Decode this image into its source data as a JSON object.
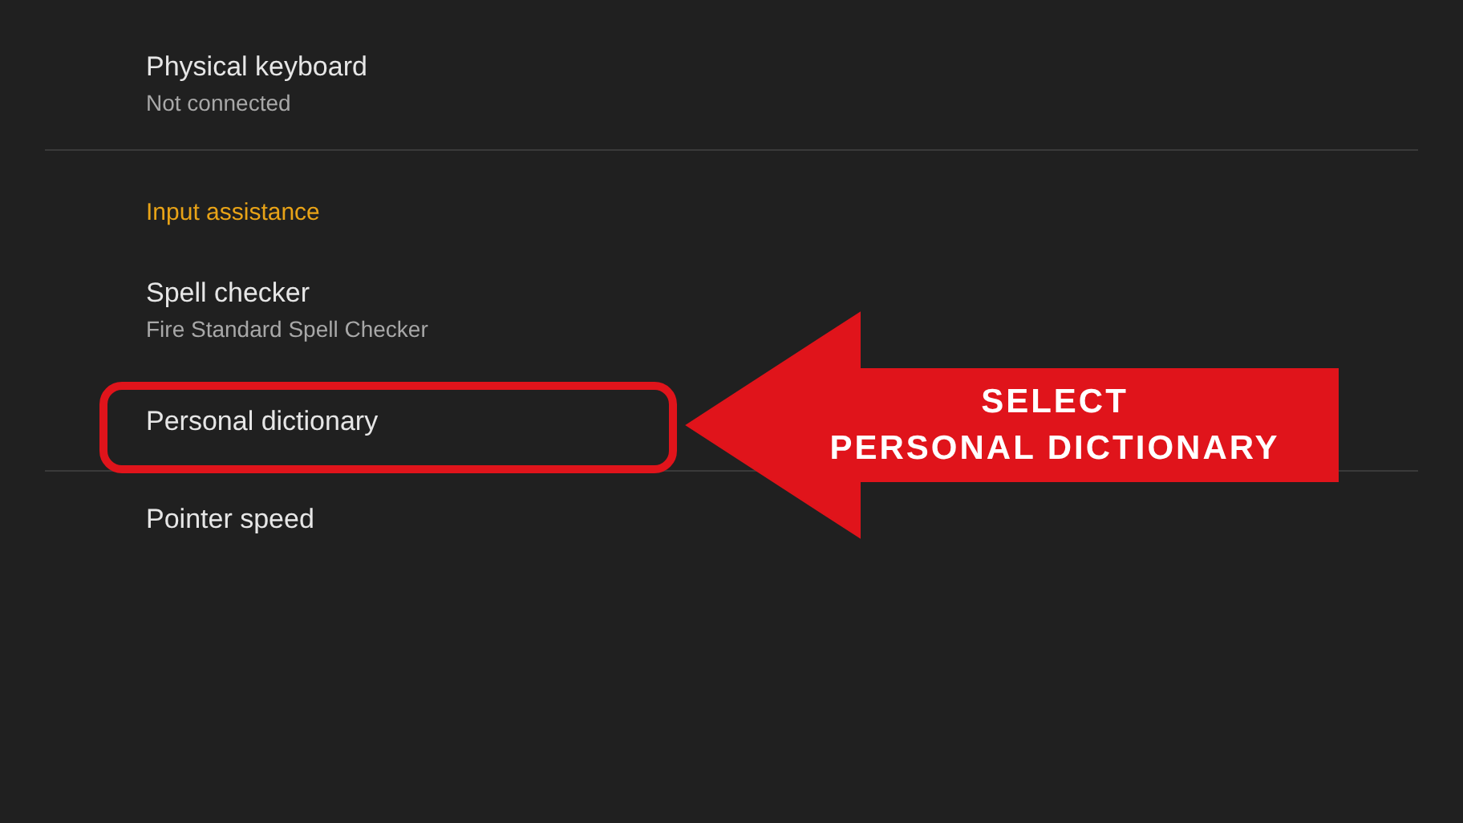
{
  "sections": [
    {
      "items": [
        {
          "title": "Physical keyboard",
          "subtitle": "Not connected",
          "highlighted": false
        }
      ]
    },
    {
      "header": "Input assistance",
      "items": [
        {
          "title": "Spell checker",
          "subtitle": "Fire Standard Spell Checker",
          "highlighted": false
        },
        {
          "title": "Personal dictionary",
          "highlighted": true
        }
      ]
    },
    {
      "items": [
        {
          "title": "Pointer speed",
          "highlighted": false
        }
      ]
    }
  ],
  "callout": {
    "lines": [
      "SELECT",
      "PERSONAL DICTIONARY"
    ]
  }
}
